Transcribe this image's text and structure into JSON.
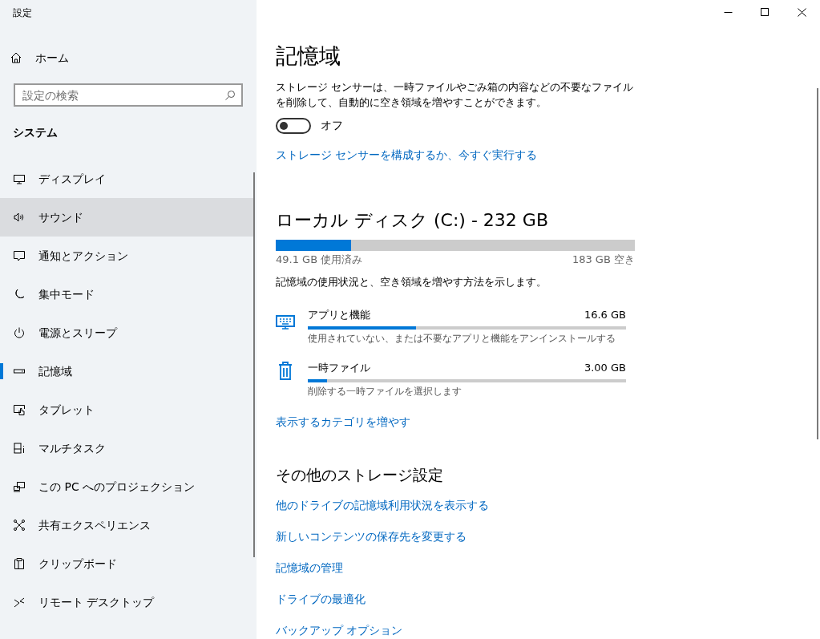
{
  "window": {
    "title": "設定"
  },
  "sidebar": {
    "home": "ホーム",
    "search": {
      "placeholder": "設定の検索"
    },
    "section": "システム",
    "items": [
      {
        "label": "ディスプレイ",
        "selected": false,
        "highlighted": false
      },
      {
        "label": "サウンド",
        "selected": false,
        "highlighted": true
      },
      {
        "label": "通知とアクション",
        "selected": false,
        "highlighted": false
      },
      {
        "label": "集中モード",
        "selected": false,
        "highlighted": false
      },
      {
        "label": "電源とスリープ",
        "selected": false,
        "highlighted": false
      },
      {
        "label": "記憶域",
        "selected": true,
        "highlighted": false
      },
      {
        "label": "タブレット",
        "selected": false,
        "highlighted": false
      },
      {
        "label": "マルチタスク",
        "selected": false,
        "highlighted": false
      },
      {
        "label": "この PC へのプロジェクション",
        "selected": false,
        "highlighted": false
      },
      {
        "label": "共有エクスペリエンス",
        "selected": false,
        "highlighted": false
      },
      {
        "label": "クリップボード",
        "selected": false,
        "highlighted": false
      },
      {
        "label": "リモート デスクトップ",
        "selected": false,
        "highlighted": false
      }
    ]
  },
  "main": {
    "title": "記憶域",
    "sensor": {
      "description": "ストレージ センサーは、一時ファイルやごみ箱の内容などの不要なファイルを削除して、自動的に空き領域を増やすことができます。",
      "on": false,
      "state_label": "オフ",
      "link": "ストレージ センサーを構成するか、今すぐ実行する"
    },
    "disk": {
      "title": "ローカル ディスク (C:) - 232 GB",
      "level": 0.21,
      "used": "49.1 GB 使用済み",
      "free": "183 GB 空き",
      "description": "記憶域の使用状況と、空き領域を増やす方法を示します。",
      "categories": [
        {
          "name": "アプリと機能",
          "size": "16.6 GB",
          "level": 0.34,
          "description": "使用されていない、または不要なアプリと機能をアンインストールする"
        },
        {
          "name": "一時ファイル",
          "size": "3.00 GB",
          "level": 0.06,
          "description": "削除する一時ファイルを選択します"
        }
      ],
      "more_link": "表示するカテゴリを増やす"
    },
    "other": {
      "title": "その他のストレージ設定",
      "links": [
        "他のドライブの記憶域利用状況を表示する",
        "新しいコンテンツの保存先を変更する",
        "記憶域の管理",
        "ドライブの最適化",
        "バックアップ オプション"
      ]
    }
  }
}
